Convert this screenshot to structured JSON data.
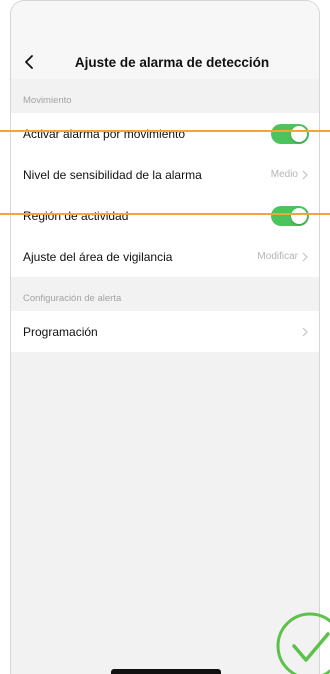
{
  "header": {
    "title": "Ajuste de alarma de detección"
  },
  "sections": [
    {
      "label": "Movimiento",
      "rows": [
        {
          "label": "Activar alarma por movimiento",
          "type": "toggle",
          "on": true
        },
        {
          "label": "Nivel de sensibilidad de la alarma",
          "type": "value",
          "value": "Medio"
        },
        {
          "label": "Región de actividad",
          "type": "toggle",
          "on": true
        },
        {
          "label": "Ajuste del área de vigilancia",
          "type": "value",
          "value": "Modificar"
        }
      ]
    },
    {
      "label": "Configuración de alerta",
      "rows": [
        {
          "label": "Programación",
          "type": "chevron"
        }
      ]
    }
  ],
  "colors": {
    "toggle_on": "#4cc45d",
    "guide_line": "#f0a63a",
    "check_overlay": "#5cc24a"
  },
  "icons": {
    "back": "chevron-left-icon",
    "row": "chevron-right-icon",
    "overlay": "checkmark-circle-icon"
  }
}
